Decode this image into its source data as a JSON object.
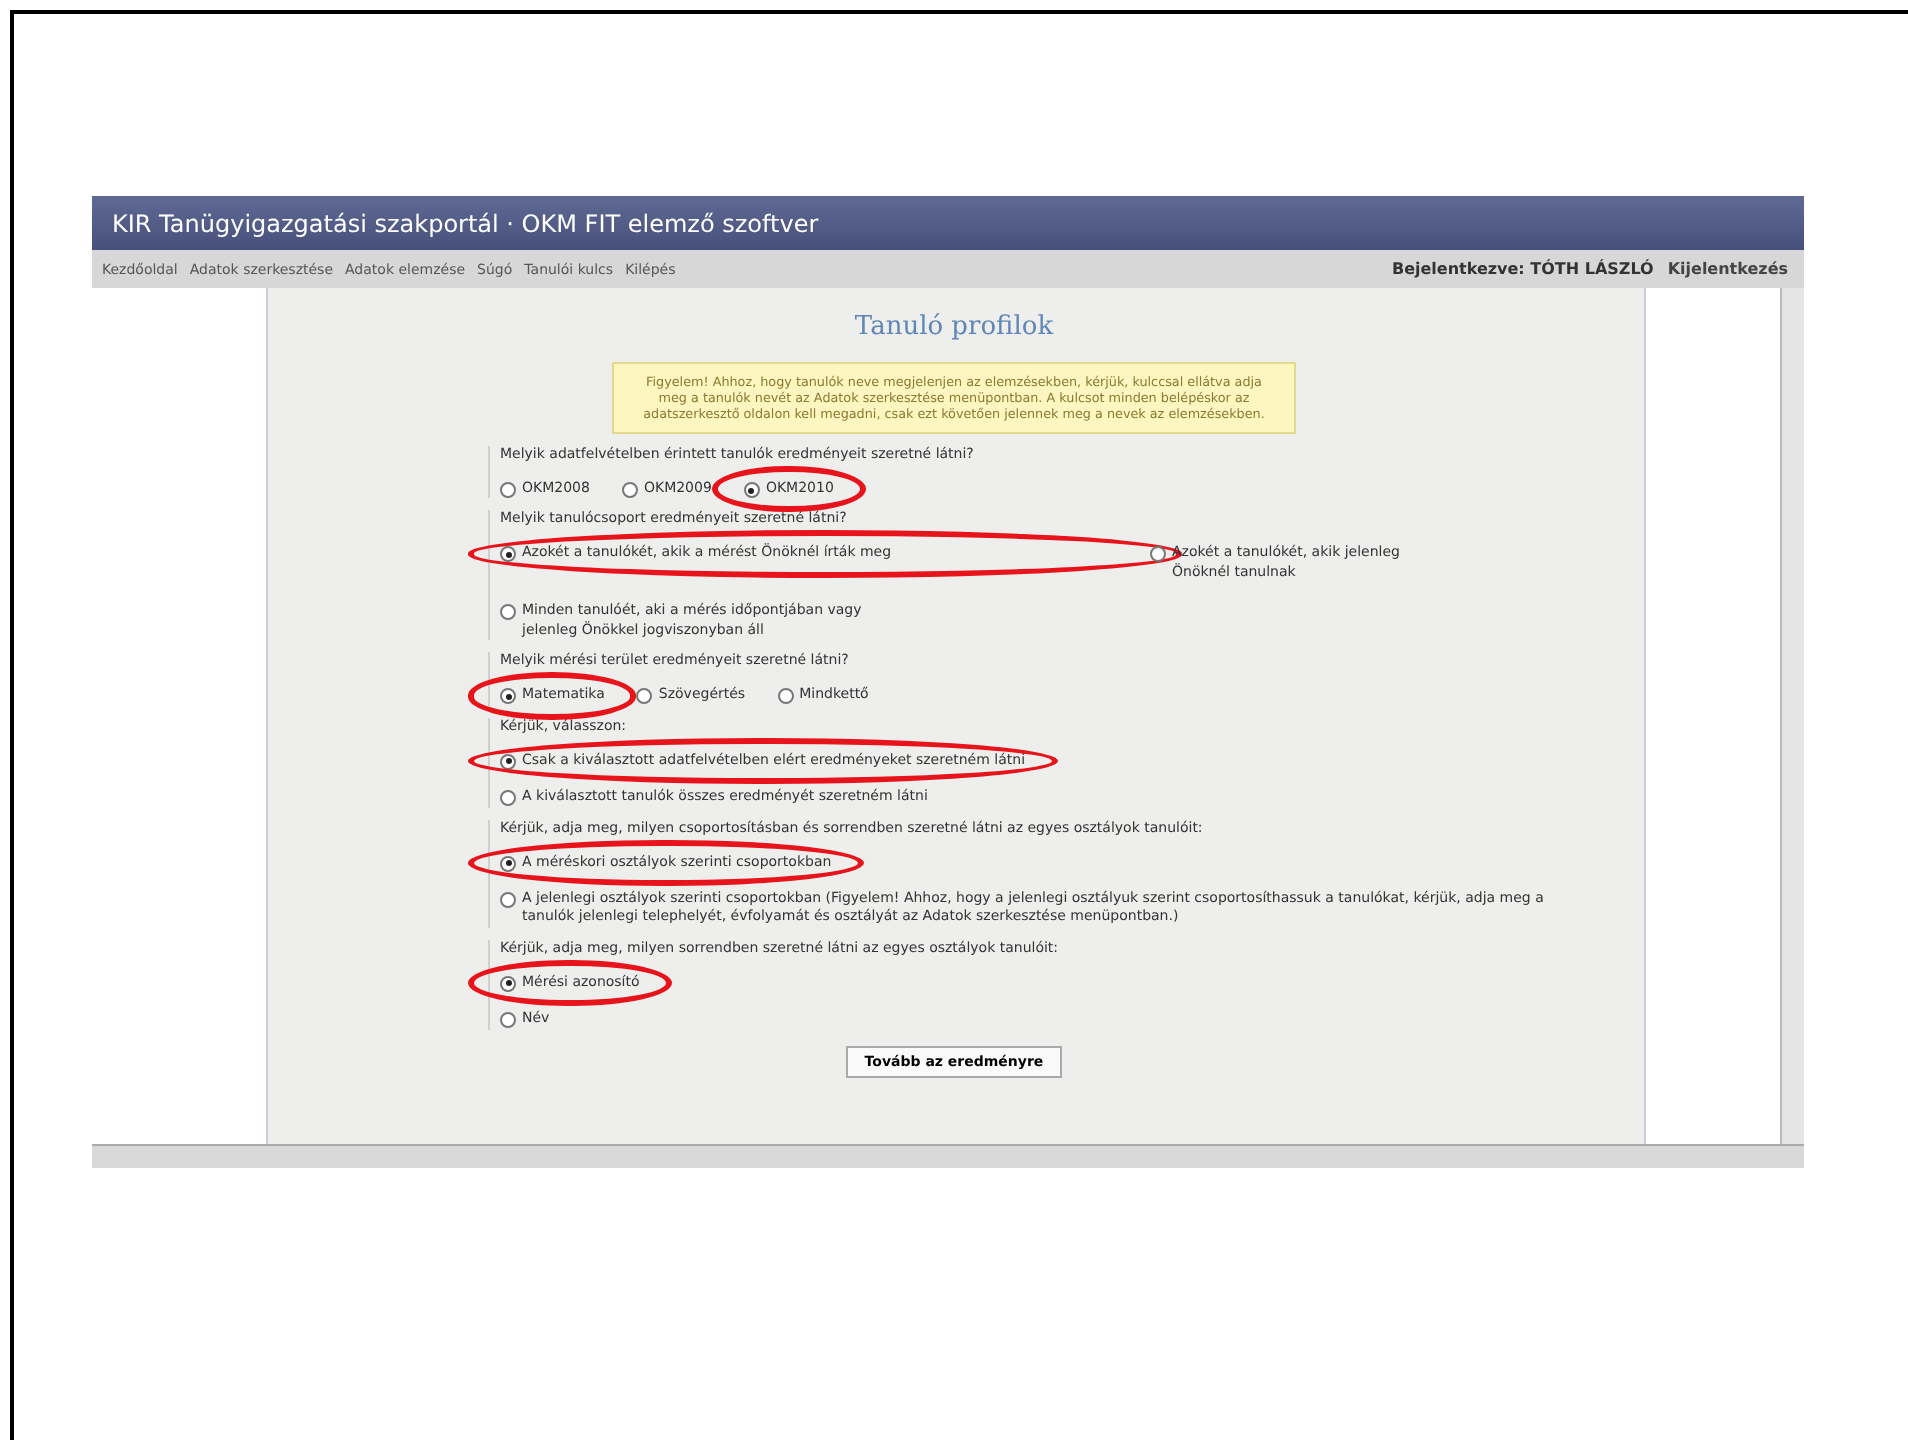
{
  "browser": {
    "title": "KIR Tanügyigazgatási szakportál · OKM FIT elemző szoftver",
    "nav": [
      "Kezdőoldal",
      "Adatok szerkesztése",
      "Adatok elemzése",
      "Súgó",
      "Tanulói kulcs",
      "Kilépés"
    ],
    "login_label": "Bejelentkezve: TÓTH LÁSZLÓ",
    "logout": "Kijelentkezés"
  },
  "page": {
    "heading": "Tanuló profilok",
    "notice": "Figyelem! Ahhoz, hogy tanulók neve megjelenjen az elemzésekben, kérjük, kulccsal ellátva adja meg a tanulók nevét az Adatok szerkesztése menüpontban. A kulcsot minden belépéskor az adatszerkesztő oldalon kell megadni, csak ezt követően jelennek meg a nevek az elemzésekben.",
    "questions": [
      {
        "kind": "inline",
        "label": "Melyik adatfelvételben érintett tanulók eredményeit szeretné látni?",
        "options": [
          {
            "text": "OKM2008",
            "selected": false,
            "circled": false
          },
          {
            "text": "OKM2009",
            "selected": false,
            "circled": false
          },
          {
            "text": "OKM2010",
            "selected": true,
            "circled": true
          }
        ]
      },
      {
        "kind": "grid",
        "label": "Melyik tanulócsoport eredményeit szeretné látni?",
        "options": [
          {
            "text": "Azokét a tanulókét, akik a mérést Önöknél írták meg",
            "selected": true,
            "circled": true
          },
          {
            "text": "Azokét a tanulókét, akik jelenleg Önöknél tanulnak",
            "selected": false,
            "circled": false
          },
          {
            "text": "Minden tanulóét, aki a mérés időpontjában vagy jelenleg Önökkel jogviszonyban áll",
            "selected": false,
            "circled": false
          }
        ]
      },
      {
        "kind": "inline",
        "label": "Melyik mérési terület eredményeit szeretné látni?",
        "options": [
          {
            "text": "Matematika",
            "selected": true,
            "circled": true
          },
          {
            "text": "Szövegértés",
            "selected": false,
            "circled": false
          },
          {
            "text": "Mindkettő",
            "selected": false,
            "circled": false
          }
        ]
      },
      {
        "kind": "stacked",
        "label": "Kérjük, válasszon:",
        "options": [
          {
            "text": "Csak a kiválasztott adatfelvételben elért eredményeket szeretném látni",
            "selected": true,
            "circled": true
          },
          {
            "text": "A kiválasztott tanulók összes eredményét szeretném látni",
            "selected": false,
            "circled": false
          }
        ]
      },
      {
        "kind": "stacked",
        "label": "Kérjük, adja meg, milyen csoportosításban és sorrendben szeretné látni az egyes osztályok tanulóit:",
        "options": [
          {
            "text": "A méréskori osztályok szerinti csoportokban",
            "selected": true,
            "circled": true
          },
          {
            "text": "A jelenlegi osztályok szerinti csoportokban (Figyelem! Ahhoz, hogy a jelenlegi osztályuk szerint csoportosíthassuk a tanulókat, kérjük, adja meg a tanulók jelenlegi telephelyét, évfolyamát és osztályát az Adatok szerkesztése menüpontban.)",
            "selected": false,
            "circled": false
          }
        ]
      },
      {
        "kind": "stacked",
        "label": "Kérjük, adja meg, milyen sorrendben szeretné látni az egyes osztályok tanulóit:",
        "options": [
          {
            "text": "Mérési azonosító",
            "selected": true,
            "circled": true
          },
          {
            "text": "Név",
            "selected": false,
            "circled": false
          }
        ]
      }
    ],
    "submit": "Tovább az eredményre"
  }
}
